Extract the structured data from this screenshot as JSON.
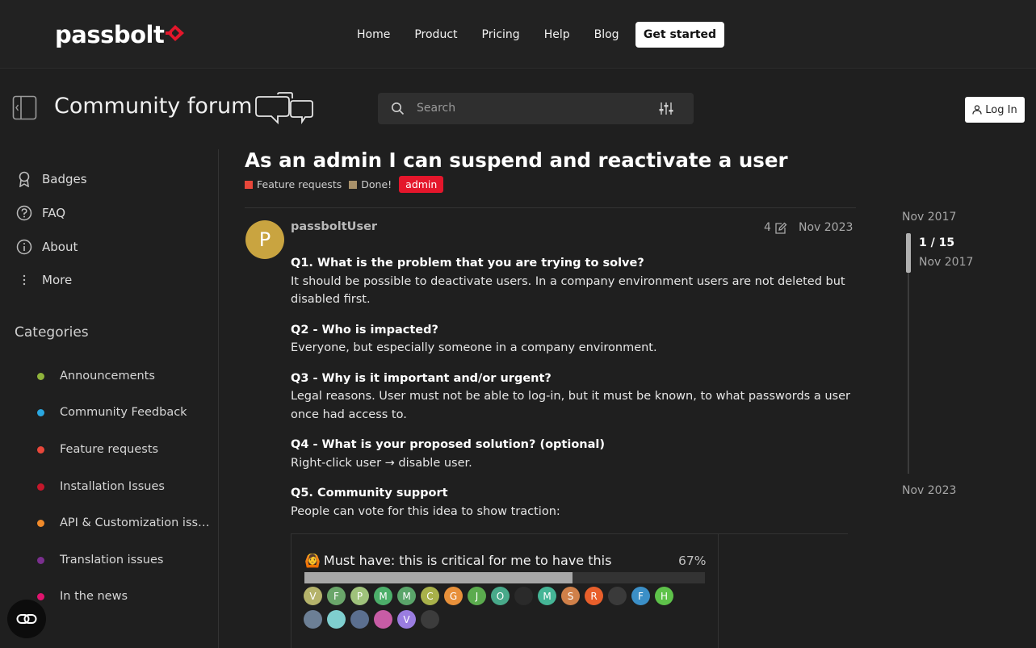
{
  "site": {
    "logo_text": "passbolt",
    "nav": [
      "Home",
      "Product",
      "Pricing",
      "Help",
      "Blog"
    ],
    "cta": "Get started"
  },
  "forum": {
    "title": "Community forum",
    "search_placeholder": "Search",
    "login": "Log In"
  },
  "sidebar": {
    "items": [
      {
        "label": "Badges",
        "icon": "badge-icon"
      },
      {
        "label": "FAQ",
        "icon": "question-icon"
      },
      {
        "label": "About",
        "icon": "info-icon"
      },
      {
        "label": "More",
        "icon": "more-vertical-icon"
      }
    ],
    "categories_heading": "Categories",
    "categories": [
      {
        "label": "Announcements",
        "color": "#8fb33b"
      },
      {
        "label": "Community Feedback",
        "color": "#2aa7e0"
      },
      {
        "label": "Feature requests",
        "color": "#e8473a"
      },
      {
        "label": "Installation Issues",
        "color": "#c4172b"
      },
      {
        "label": "API & Customization iss…",
        "color": "#f08a2a"
      },
      {
        "label": "Translation issues",
        "color": "#7a2f8e"
      },
      {
        "label": "In the news",
        "color": "#e0146e"
      }
    ]
  },
  "topic": {
    "title": "As an admin I can suspend and reactivate a user",
    "category_primary": {
      "label": "Feature requests",
      "color": "#e8473a"
    },
    "category_secondary": {
      "label": "Done!",
      "color": "#a8916a"
    },
    "tag": "admin"
  },
  "post": {
    "avatar_letter": "P",
    "username": "passboltUser",
    "edit_count": "4",
    "date": "Nov 2023",
    "sections": [
      {
        "q": "Q1. What is the problem that you are trying to solve?",
        "a": "It should be possible to deactivate users. In a company environment users are not deleted but disabled first."
      },
      {
        "q": "Q2 - Who is impacted?",
        "a": "Everyone, but especially someone in a company environment."
      },
      {
        "q": "Q3 - Why is it important and/or urgent?",
        "a": "Legal reasons. User must not be able to log-in, but it must be known, to what passwords a user once had access to."
      },
      {
        "q": "Q4 - What is your proposed solution? (optional)",
        "a": "Right-click user → disable user."
      },
      {
        "q": "Q5. Community support",
        "a": "People can vote for this idea to show traction:"
      }
    ]
  },
  "poll": {
    "option_label": "Must have: this is critical for me to have this",
    "option_emoji": "🙆",
    "percent_label": "67%",
    "percent_value": 0.67,
    "voters": [
      {
        "letter": "V",
        "color": "#b5b36b"
      },
      {
        "letter": "F",
        "color": "#6aa66a"
      },
      {
        "letter": "P",
        "color": "#9fc27b"
      },
      {
        "letter": "M",
        "color": "#4caf6a"
      },
      {
        "letter": "M",
        "color": "#5aa56a"
      },
      {
        "letter": "C",
        "color": "#a8b14a"
      },
      {
        "letter": "G",
        "color": "#e8903a"
      },
      {
        "letter": "J",
        "color": "#5bab4e"
      },
      {
        "letter": "O",
        "color": "#48a98a"
      },
      {
        "letter": "",
        "color": "#2a2a2a"
      },
      {
        "letter": "M",
        "color": "#45b596"
      },
      {
        "letter": "S",
        "color": "#d08049"
      },
      {
        "letter": "R",
        "color": "#e85f2b"
      },
      {
        "letter": "",
        "color": "#3a3a3a"
      },
      {
        "letter": "F",
        "color": "#3b8fc7"
      },
      {
        "letter": "H",
        "color": "#5ec24a"
      },
      {
        "letter": "",
        "color": "#6c7f95"
      },
      {
        "letter": "",
        "color": "#7fcfcf"
      },
      {
        "letter": "",
        "color": "#5b6f8f"
      },
      {
        "letter": "",
        "color": "#c75ca5"
      },
      {
        "letter": "V",
        "color": "#9a7de0"
      },
      {
        "letter": "",
        "color": "#3c3c3c"
      }
    ]
  },
  "timeline": {
    "start": "Nov 2017",
    "position": "1 / 15",
    "position_date": "Nov 2017",
    "end": "Nov 2023"
  }
}
